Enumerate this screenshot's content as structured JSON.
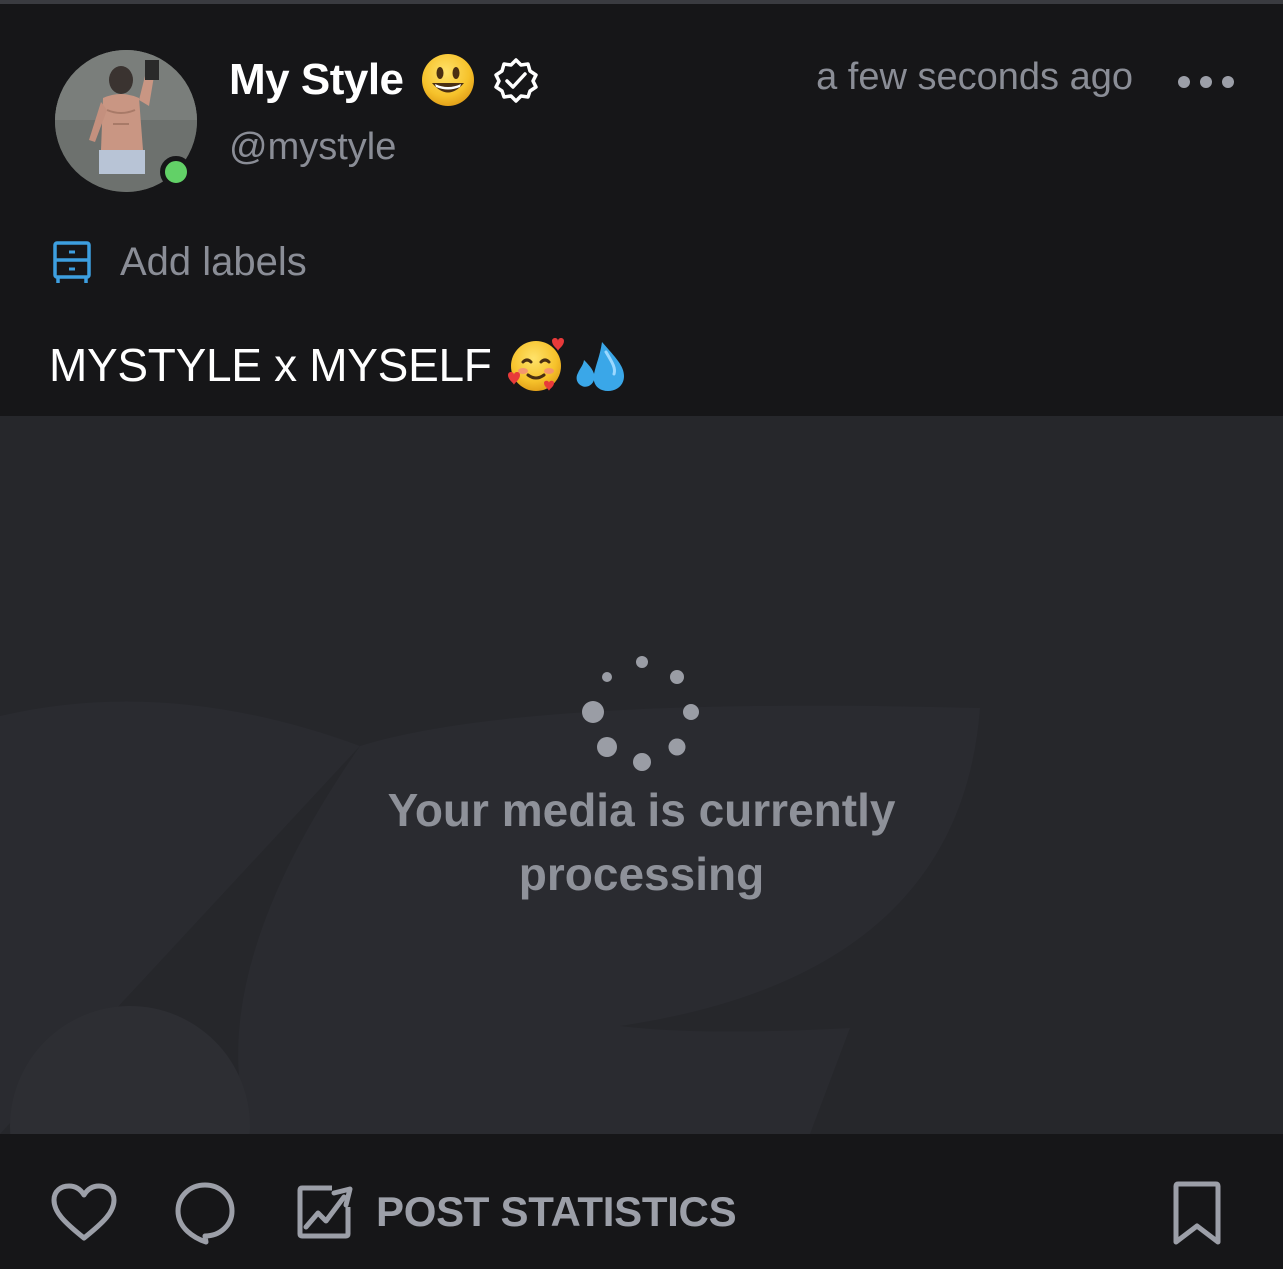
{
  "post": {
    "author": {
      "display_name": "My Style",
      "username": "@mystyle",
      "name_emoji": "smiling-face-emoji",
      "verified": true,
      "online": true,
      "online_color": "#62d167"
    },
    "timestamp": "a few seconds ago",
    "labels": {
      "add_label_text": "Add labels",
      "icon": "dresser-icon",
      "icon_color": "#3d9fe0"
    },
    "caption": {
      "text": "MYSTYLE x MYSELF",
      "emojis": [
        "smiling-face-with-hearts-emoji",
        "sweat-droplets-emoji"
      ]
    },
    "media": {
      "status_line_1": "Your media is currently",
      "status_line_2": "processing"
    },
    "actions": {
      "like_icon": "heart-icon",
      "comment_icon": "comment-icon",
      "stats_icon": "chart-image-icon",
      "stats_label": "POST STATISTICS",
      "bookmark_icon": "bookmark-icon"
    }
  },
  "colors": {
    "background": "#161618",
    "media_background": "#26272b",
    "primary_text": "#ffffff",
    "secondary_text": "#8a8d96",
    "icon_gray": "#9c9fa8"
  }
}
